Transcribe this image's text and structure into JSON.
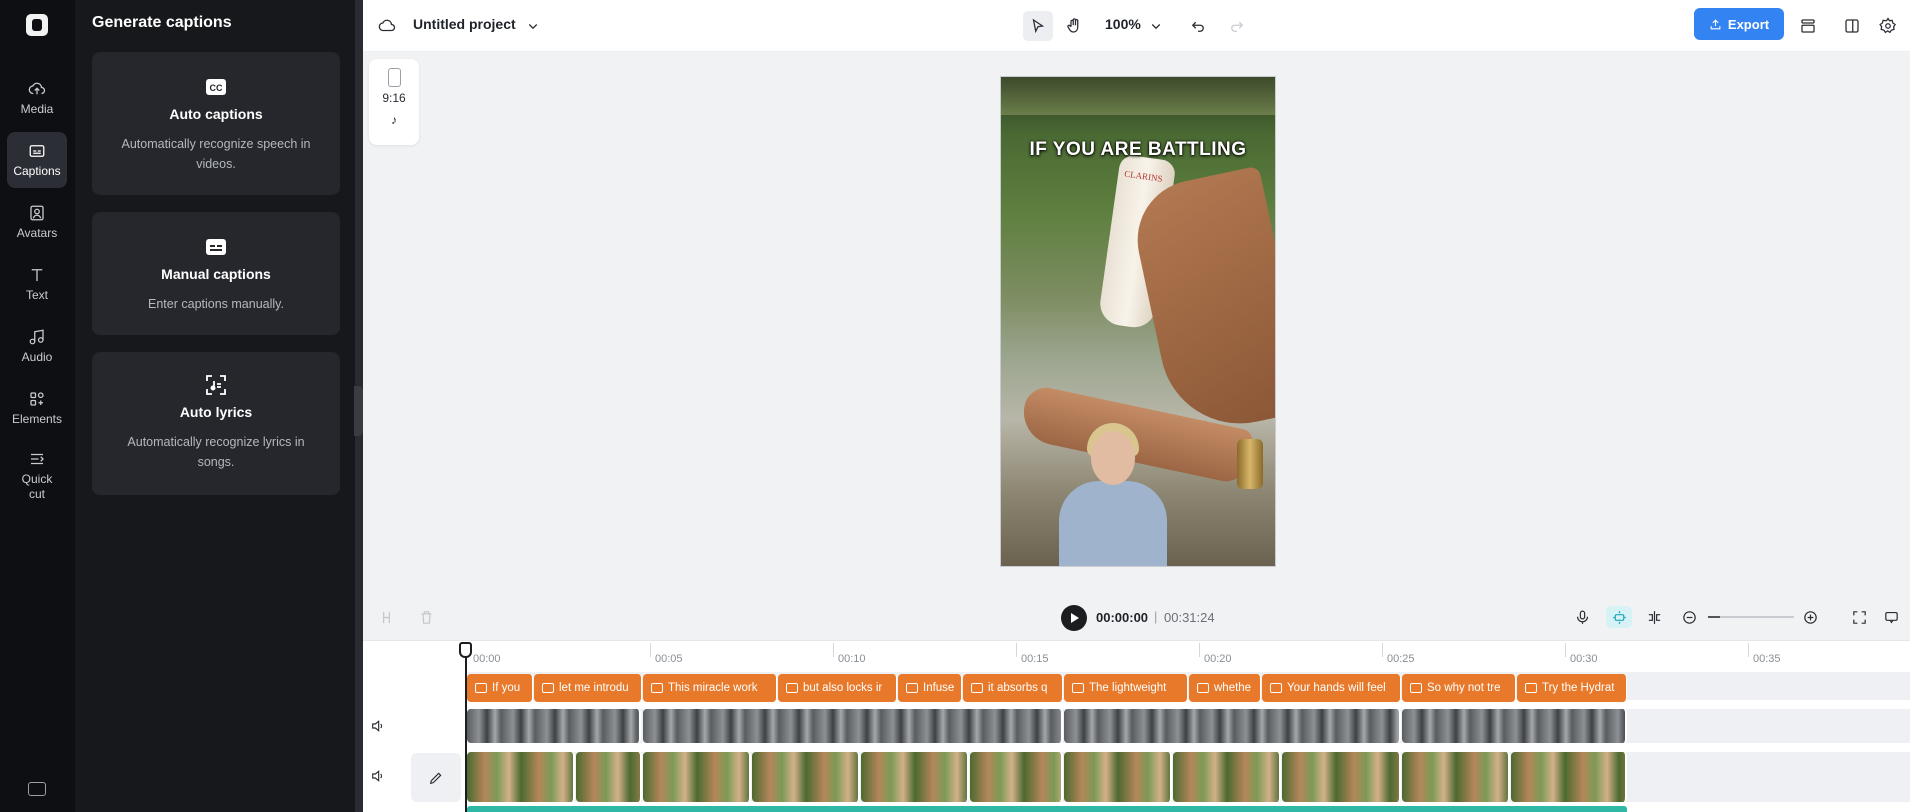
{
  "app": {
    "colors": {
      "accent": "#3384f2",
      "captions": "#e8792a",
      "audio": "#2fb8a3",
      "rail": "#0e0f12",
      "panel": "#17181c"
    }
  },
  "rail": {
    "items": [
      {
        "label": "Media",
        "icon": "cloud-upload-icon"
      },
      {
        "label": "Captions",
        "icon": "captions-icon",
        "active": true
      },
      {
        "label": "Avatars",
        "icon": "avatar-icon"
      },
      {
        "label": "Text",
        "icon": "text-icon"
      },
      {
        "label": "Audio",
        "icon": "music-note-icon"
      },
      {
        "label": "Elements",
        "icon": "elements-icon"
      },
      {
        "label": "Quick\ncut",
        "icon": "quick-cut-icon"
      }
    ]
  },
  "panel": {
    "title": "Generate captions",
    "cards": [
      {
        "title": "Auto captions",
        "desc": "Automatically recognize speech in videos.",
        "icon": "cc-icon"
      },
      {
        "title": "Manual captions",
        "desc": "Enter captions manually.",
        "icon": "subtitles-icon"
      },
      {
        "title": "Auto lyrics",
        "desc": "Automatically recognize lyrics in songs.",
        "icon": "lyrics-scan-icon"
      }
    ]
  },
  "topbar": {
    "project_name": "Untitled project",
    "zoom": "100%",
    "export_label": "Export"
  },
  "canvas": {
    "ratio": "9:16",
    "caption_overlay": "IF YOU ARE BATTLING",
    "product_brand": "CLARINS"
  },
  "timeline": {
    "current_time": "00:00:00",
    "separator": "|",
    "total_time": "00:31:24",
    "ruler": [
      "00:00",
      "00:05",
      "00:10",
      "00:15",
      "00:20",
      "00:25",
      "00:30",
      "00:35"
    ],
    "caption_clips": [
      "If you",
      "let me introdu",
      "This miracle work",
      "but also locks ir",
      "Infuse",
      "it absorbs q",
      "The lightweight",
      "whethe",
      "Your hands will feel",
      "So why not tre",
      "Try the Hydrat"
    ]
  }
}
